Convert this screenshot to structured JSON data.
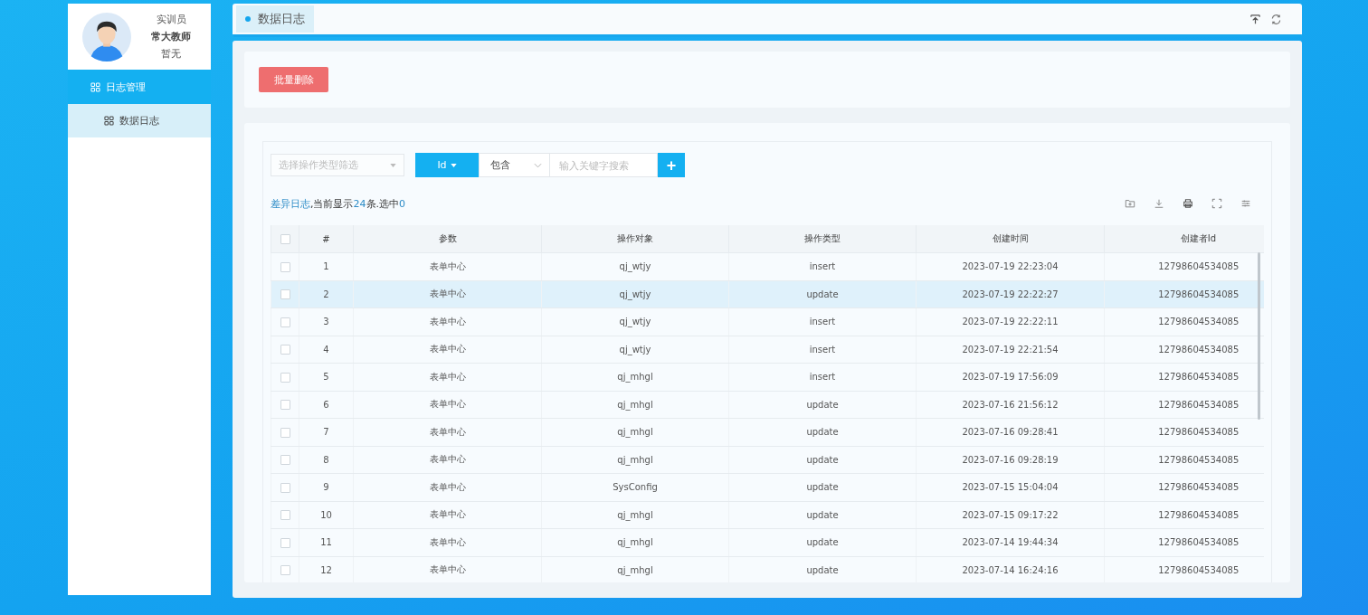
{
  "profile": {
    "role": "实训员",
    "name": "常大教师",
    "note": "暂无"
  },
  "sidebar": {
    "items": [
      {
        "label": "日志管理",
        "selected": true,
        "children": [
          {
            "label": "数据日志",
            "selected": true
          }
        ]
      }
    ]
  },
  "tabs": [
    {
      "label": "数据日志",
      "selected": true
    }
  ],
  "toolbar": {
    "delete_button": "批量删除"
  },
  "filters": {
    "type_select": {
      "placeholder": "选择操作类型筛选"
    },
    "field_button": "Id",
    "operator": "包含",
    "keyword": {
      "placeholder": "输入关键字搜索"
    },
    "add_button": "+"
  },
  "summary": [
    {
      "text": "差异日志",
      "kind": "accent"
    },
    {
      "text": ",当前显示",
      "kind": "plain"
    },
    {
      "text": "24",
      "kind": "accent"
    },
    {
      "text": "条.选中",
      "kind": "plain"
    },
    {
      "text": "0",
      "kind": "accent"
    }
  ],
  "table": {
    "header_checked": false,
    "columns": [
      "#",
      "参数",
      "操作对象",
      "操作类型",
      "创建时间",
      "创建者Id"
    ],
    "rows": [
      {
        "checked": false,
        "highlighted": false,
        "cells": [
          "1",
          "表单中心",
          "qj_wtjy",
          "insert",
          "2023-07-19 22:23:04",
          "12798604534085"
        ]
      },
      {
        "checked": false,
        "highlighted": true,
        "cells": [
          "2",
          "表单中心",
          "qj_wtjy",
          "update",
          "2023-07-19 22:22:27",
          "12798604534085"
        ]
      },
      {
        "checked": false,
        "highlighted": false,
        "cells": [
          "3",
          "表单中心",
          "qj_wtjy",
          "insert",
          "2023-07-19 22:22:11",
          "12798604534085"
        ]
      },
      {
        "checked": false,
        "highlighted": false,
        "cells": [
          "4",
          "表单中心",
          "qj_wtjy",
          "insert",
          "2023-07-19 22:21:54",
          "12798604534085"
        ]
      },
      {
        "checked": false,
        "highlighted": false,
        "cells": [
          "5",
          "表单中心",
          "qj_mhgl",
          "insert",
          "2023-07-19 17:56:09",
          "12798604534085"
        ]
      },
      {
        "checked": false,
        "highlighted": false,
        "cells": [
          "6",
          "表单中心",
          "qj_mhgl",
          "update",
          "2023-07-16 21:56:12",
          "12798604534085"
        ]
      },
      {
        "checked": false,
        "highlighted": false,
        "cells": [
          "7",
          "表单中心",
          "qj_mhgl",
          "update",
          "2023-07-16 09:28:41",
          "12798604534085"
        ]
      },
      {
        "checked": false,
        "highlighted": false,
        "cells": [
          "8",
          "表单中心",
          "qj_mhgl",
          "update",
          "2023-07-16 09:28:19",
          "12798604534085"
        ]
      },
      {
        "checked": false,
        "highlighted": false,
        "cells": [
          "9",
          "表单中心",
          "SysConfig",
          "update",
          "2023-07-15 15:04:04",
          "12798604534085"
        ]
      },
      {
        "checked": false,
        "highlighted": false,
        "cells": [
          "10",
          "表单中心",
          "qj_mhgl",
          "update",
          "2023-07-15 09:17:22",
          "12798604534085"
        ]
      },
      {
        "checked": false,
        "highlighted": false,
        "cells": [
          "11",
          "表单中心",
          "qj_mhgl",
          "update",
          "2023-07-14 19:44:34",
          "12798604534085"
        ]
      },
      {
        "checked": false,
        "highlighted": false,
        "cells": [
          "12",
          "表单中心",
          "qj_mhgl",
          "update",
          "2023-07-14 16:24:16",
          "12798604534085"
        ]
      }
    ]
  }
}
